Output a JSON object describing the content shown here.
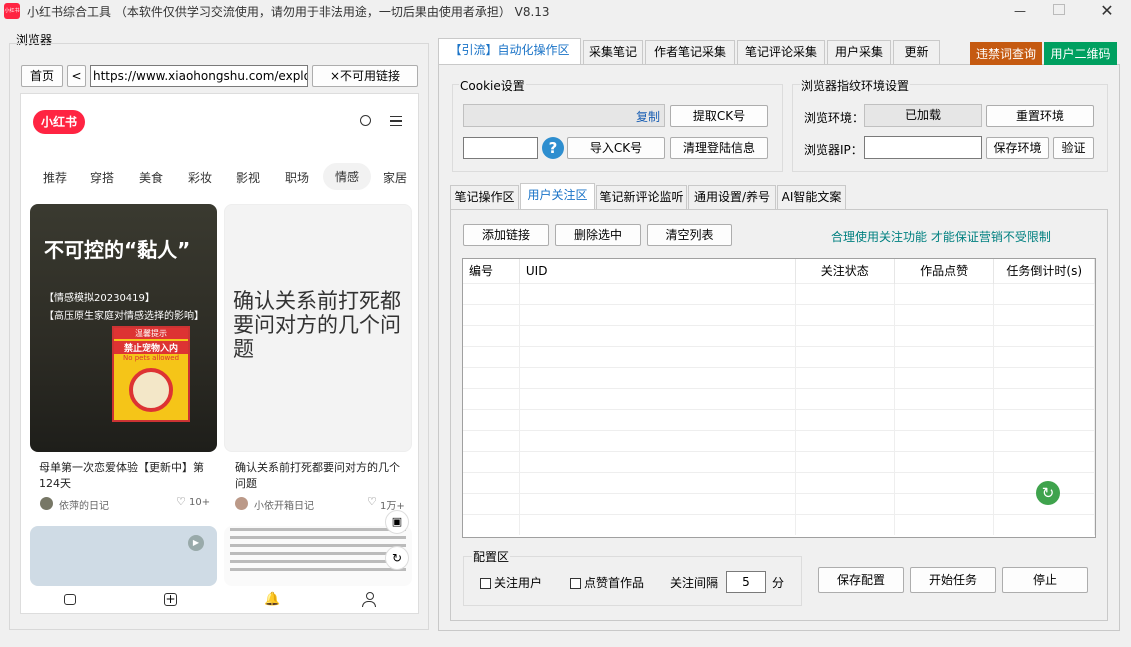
{
  "window": {
    "title": "小红书综合工具 （本软件仅供学习交流使用，请勿用于非法用途，一切后果由使用者承担） V8.13",
    "icon_text": "小红书"
  },
  "browser": {
    "label": "浏览器",
    "home": "首页",
    "back": "<",
    "url": "https://www.xiaohongshu.com/explore",
    "disabled_link": "×不可用链接"
  },
  "phone": {
    "logo": "小红书",
    "nav": [
      "推荐",
      "穿搭",
      "美食",
      "彩妆",
      "影视",
      "职场",
      "情感",
      "家居"
    ],
    "active_nav": "情感",
    "cards": [
      {
        "image_title": "不可控的“黏人”",
        "image_sub1": "【情感模拟20230419】",
        "image_sub2": "【高压原生家庭对情感选择的影响】",
        "sign_top": "温馨提示",
        "sign_main": "禁止宠物入内",
        "sign_sub": "No pets allowed",
        "caption": "母单第一次恋爱体验【更新中】第124天",
        "author": "依萍的日记",
        "likes": "10+"
      },
      {
        "image_text": "确认关系前打死都要问对方的几个问题",
        "caption": "确认关系前打死都要问对方的几个问题",
        "author": "小依开箱日记",
        "likes": "1万+"
      }
    ]
  },
  "top_tabs": [
    "【引流】自动化操作区",
    "采集笔记",
    "作者笔记采集",
    "笔记评论采集",
    "用户采集",
    "更新"
  ],
  "top_right_buttons": [
    "违禁词查询",
    "用户二维码"
  ],
  "cookie": {
    "title": "Cookie设置",
    "copy": "复制",
    "extract": "提取CK号",
    "import": "导入CK号",
    "clear": "清理登陆信息"
  },
  "fingerprint": {
    "title": "浏览器指纹环境设置",
    "env_label": "浏览环境：",
    "env_value": "已加载",
    "reset": "重置环境",
    "ip_label": "浏览器IP：",
    "save": "保存环境",
    "verify": "验证"
  },
  "sub_tabs": [
    "笔记操作区",
    "用户关注区",
    "笔记新评论监听",
    "通用设置/养号",
    "AI智能文案"
  ],
  "actions": {
    "add": "添加链接",
    "delete": "删除选中",
    "clear": "清空列表",
    "hint": "合理使用关注功能 才能保证营销不受限制"
  },
  "table": {
    "headers": [
      "编号",
      "UID",
      "关注状态",
      "作品点赞",
      "任务倒计时(s)"
    ],
    "empty_rows": 12
  },
  "config": {
    "title": "配置区",
    "follow_user": "关注用户",
    "like_first": "点赞首作品",
    "interval_label": "关注间隔",
    "interval_value": "5",
    "unit": "分",
    "save": "保存配置",
    "start": "开始任务",
    "stop": "停止"
  },
  "colors": {
    "accent": "#1a73c7",
    "orange": "#c55a11",
    "green": "#00a060",
    "xhs_red": "#ff2442"
  }
}
